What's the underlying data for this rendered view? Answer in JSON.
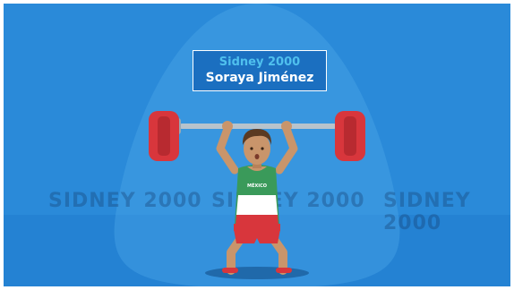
{
  "caption": {
    "year": "Sidney 2000",
    "name": "Soraya Jiménez"
  },
  "watermark": {
    "text": "SIDNEY 2000"
  },
  "jersey": {
    "text": "MÉXICO"
  },
  "colors": {
    "background": "#2a8ad9",
    "weight_plate": "#d8363c",
    "jersey_green": "#3a9a5a",
    "shorts_red": "#d8363c",
    "skin": "#c9956b"
  }
}
